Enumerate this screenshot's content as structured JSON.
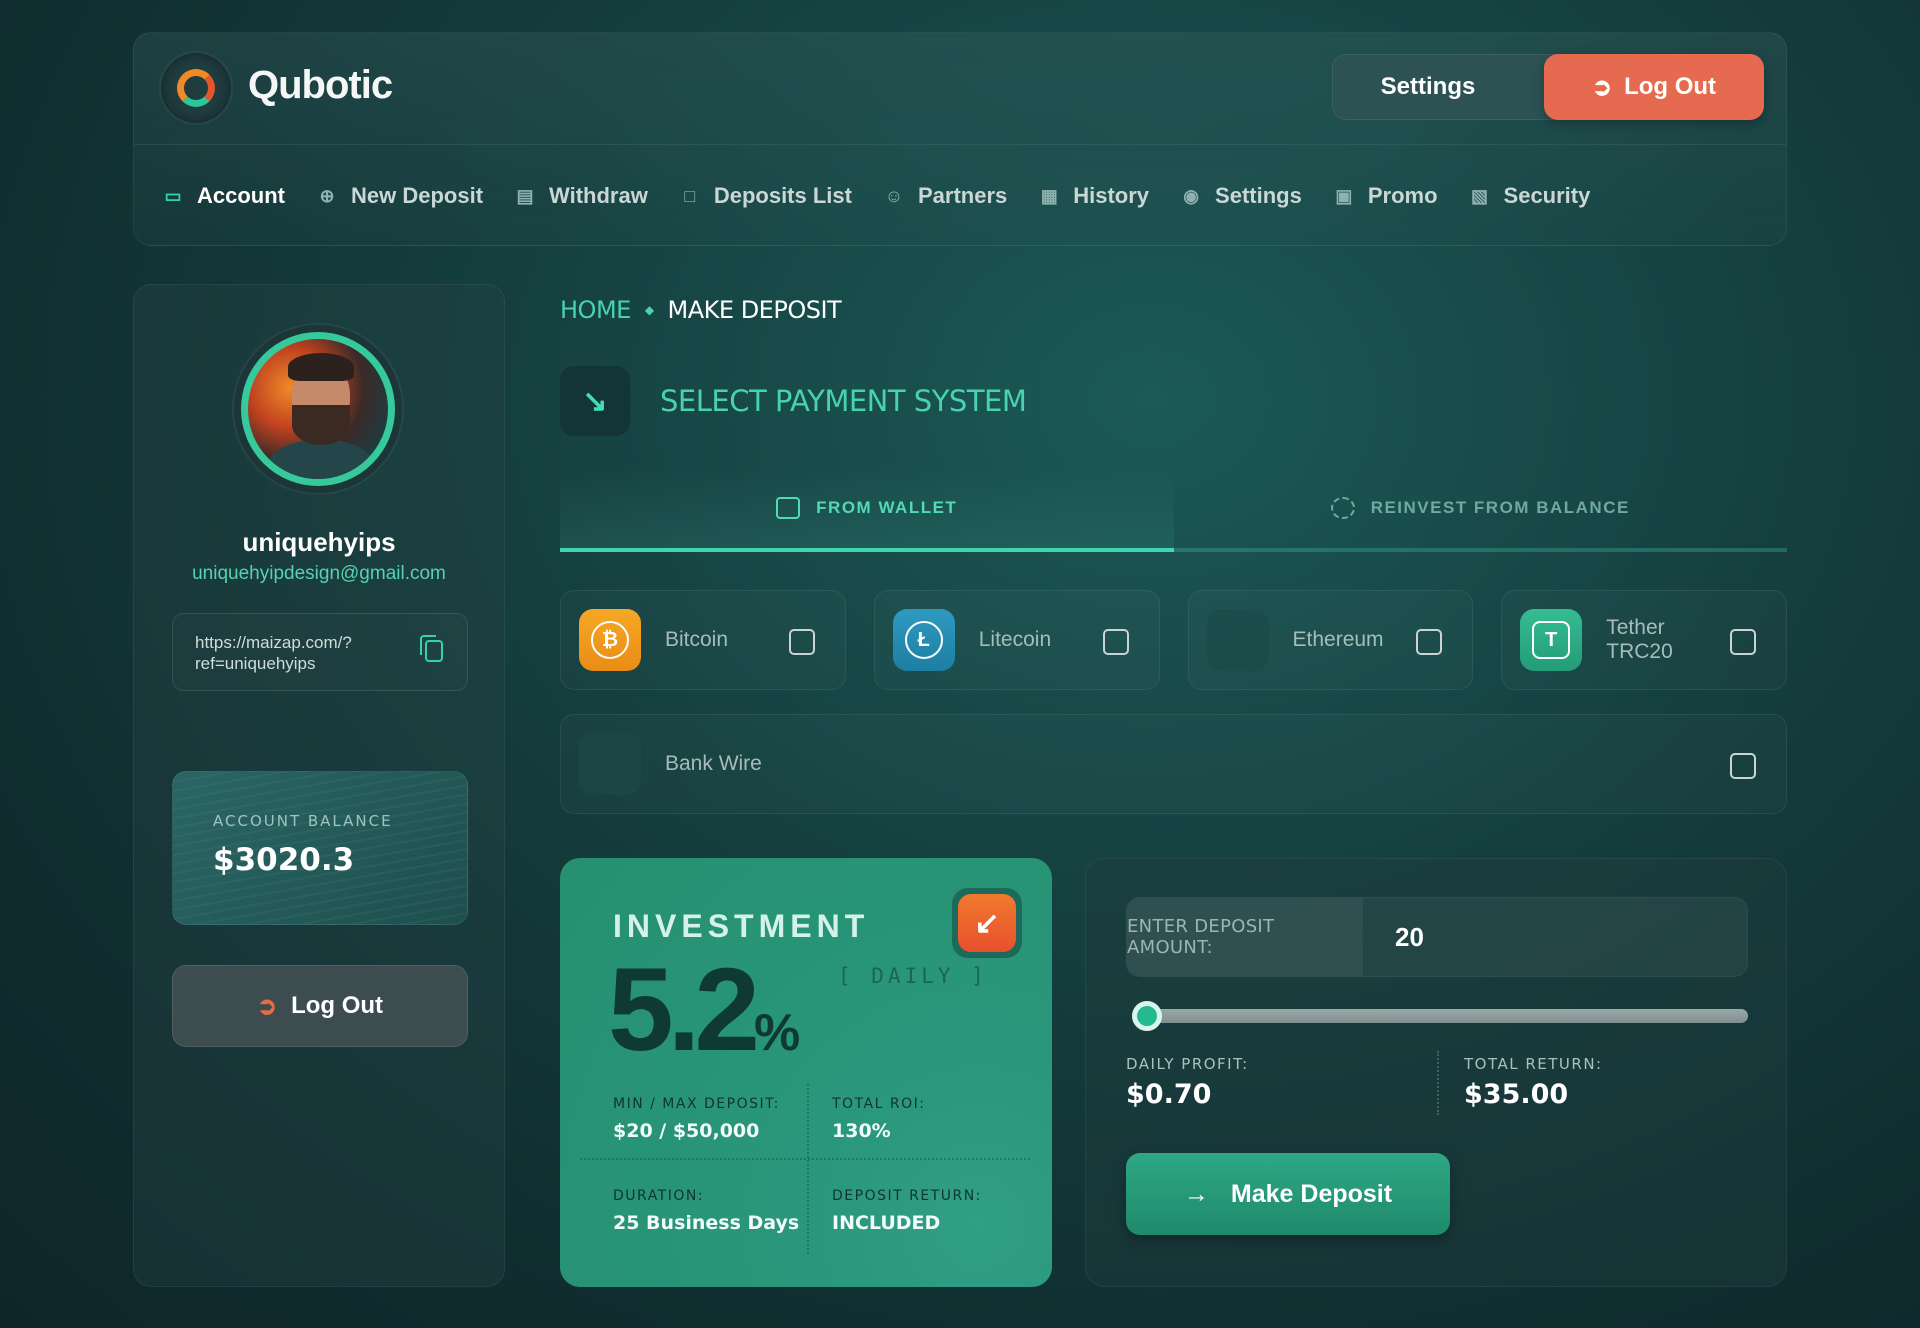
{
  "brand": {
    "name": "Qubotic"
  },
  "header": {
    "settings_label": "Settings",
    "logout_label": "Log Out"
  },
  "nav": {
    "items": [
      {
        "label": "Account",
        "icon": "laptop-icon",
        "active": true
      },
      {
        "label": "New Deposit",
        "icon": "plus-circle-icon"
      },
      {
        "label": "Withdraw",
        "icon": "card-icon"
      },
      {
        "label": "Deposits List",
        "icon": "folder-icon"
      },
      {
        "label": "Partners",
        "icon": "users-icon"
      },
      {
        "label": "History",
        "icon": "calendar-icon"
      },
      {
        "label": "Settings",
        "icon": "toggle-icon"
      },
      {
        "label": "Promo",
        "icon": "image-icon"
      },
      {
        "label": "Security",
        "icon": "document-lock-icon"
      }
    ]
  },
  "profile": {
    "username": "uniquehyips",
    "email": "uniquehyipdesign@gmail.com",
    "ref_line1": "https://maizap.com/?",
    "ref_line2": "ref=uniquehyips",
    "balance_label": "ACCOUNT BALANCE",
    "balance_value": "$3020.3",
    "logout_label": "Log Out"
  },
  "breadcrumb": {
    "home": "HOME",
    "current": "MAKE DEPOSIT"
  },
  "section": {
    "title": "SELECT PAYMENT SYSTEM"
  },
  "tabs": [
    {
      "label": "FROM WALLET",
      "active": true
    },
    {
      "label": "REINVEST FROM BALANCE",
      "active": false
    }
  ],
  "payments": {
    "bitcoin": {
      "label": "Bitcoin",
      "color": "#f09a1c"
    },
    "litecoin": {
      "label": "Litecoin",
      "color": "#2a8fb3"
    },
    "ethereum": {
      "label": "Ethereum",
      "color": "#1d4a48"
    },
    "tether_line1": "Tether",
    "tether_line2": "TRC20",
    "tether_color": "#2fb08a",
    "bankwire": {
      "label": "Bank Wire",
      "color": "#1d4a48"
    }
  },
  "investment": {
    "title": "INVESTMENT",
    "rate": "5.2",
    "rate_unit": "%",
    "period": "[ DAILY ]",
    "min_max_label": "MIN / MAX DEPOSIT:",
    "min_max_value": "$20 / $50,000",
    "roi_label": "TOTAL ROI:",
    "roi_value": "130%",
    "duration_label": "DURATION:",
    "duration_value": "25 Business Days",
    "return_label": "DEPOSIT RETURN:",
    "return_value": "INCLUDED"
  },
  "calculator": {
    "amount_label": "ENTER DEPOSIT AMOUNT:",
    "amount_value": "20",
    "slider_fraction": 0.0,
    "daily_profit_label": "DAILY PROFIT:",
    "daily_profit_value": "$0.70",
    "total_return_label": "TOTAL RETURN:",
    "total_return_value": "$35.00",
    "button_label": "Make Deposit"
  },
  "colors": {
    "accent": "#33d4a8",
    "logout": "#e56a4f"
  }
}
